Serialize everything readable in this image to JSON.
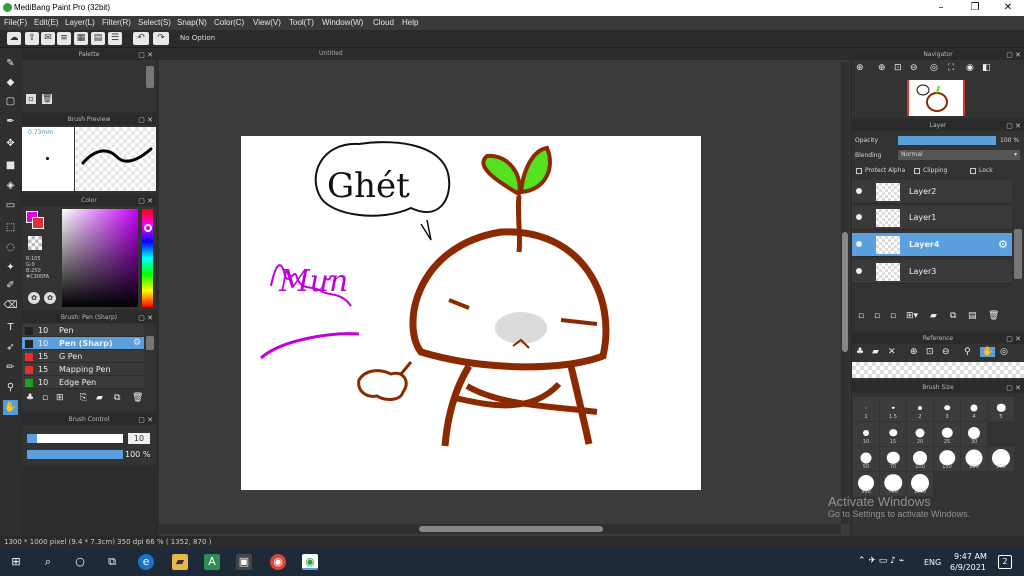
{
  "window": {
    "title": "MediBang Paint Pro (32bit)",
    "minimize": "–",
    "maximize": "❐",
    "close": "✕"
  },
  "menu": [
    "File(F)",
    "Edit(E)",
    "Layer(L)",
    "Filter(R)",
    "Select(S)",
    "Snap(N)",
    "Color(C)",
    "View(V)",
    "Tool(T)",
    "Window(W)",
    "Cloud",
    "Help"
  ],
  "toolbar": {
    "option_text": "No Option"
  },
  "panels": {
    "palette": "Palette",
    "brush_preview": "Brush Preview",
    "brush_preview_size": "0.73mm",
    "color": "Color",
    "color_values": [
      "R:105",
      "G:0",
      "B:250",
      "#C300FA"
    ],
    "brush_list_title": "Brush: Pen (Sharp)",
    "brush_control": "Brush Control",
    "navigator": "Navigator",
    "layer": "Layer",
    "reference": "Reference",
    "brush_size": "Brush Size"
  },
  "brushes": [
    {
      "size": "10",
      "name": "Pen",
      "color": "#222222",
      "selected": false
    },
    {
      "size": "10",
      "name": "Pen (Sharp)",
      "color": "#222222",
      "selected": true
    },
    {
      "size": "15",
      "name": "G Pen",
      "color": "#e03030",
      "selected": false
    },
    {
      "size": "15",
      "name": "Mapping Pen",
      "color": "#e03030",
      "selected": false
    },
    {
      "size": "10",
      "name": "Edge Pen",
      "color": "#20a020",
      "selected": false
    }
  ],
  "brush_control": {
    "size_value": "10",
    "opacity_value": "100 %",
    "size_fraction": 0.1,
    "opacity_fraction": 1.0
  },
  "layer": {
    "opacity_label": "Opacity",
    "opacity_value": "100 %",
    "blending_label": "Blending",
    "blending_value": "Normal",
    "protect_alpha": "Protect Alpha",
    "clipping": "Clipping",
    "lock": "Lock",
    "layers": [
      {
        "name": "Layer2",
        "selected": false
      },
      {
        "name": "Layer1",
        "selected": false
      },
      {
        "name": "Layer4",
        "selected": true
      },
      {
        "name": "Layer3",
        "selected": false
      }
    ]
  },
  "canvas": {
    "tab_title": "Untitled",
    "text_bubble": "Ghét",
    "text_side": "Mưn"
  },
  "brush_sizes": [
    [
      "1",
      "1.5",
      "2",
      "3",
      "4",
      "5"
    ],
    [
      "10",
      "15",
      "20",
      "25",
      "30"
    ],
    [
      "50",
      "70",
      "100",
      "150",
      "200",
      "300"
    ],
    [
      "500",
      "700",
      "1000"
    ]
  ],
  "status": "1300 * 1000 pixel  (9.4 * 7.3cm)  350 dpi  66 %  ( 1352, 870 )",
  "watermark": {
    "line1": "Activate Windows",
    "line2": "Go to Settings to activate Windows."
  },
  "taskbar": {
    "time": "9:47 AM",
    "date": "6/9/2021",
    "lang": "ENG",
    "notif_count": "2"
  },
  "colors": {
    "selected_main": "#e000e0",
    "selected_sub": "#e03030",
    "accent": "#5ba0dc"
  }
}
